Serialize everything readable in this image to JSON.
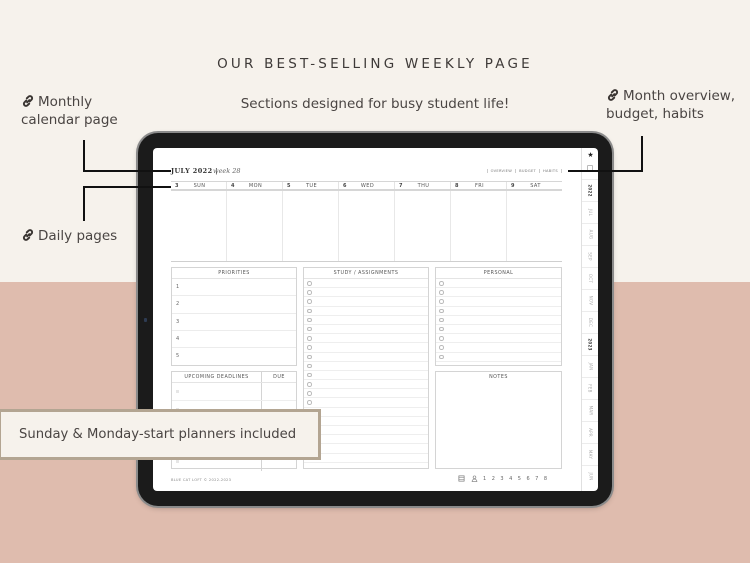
{
  "header": {
    "title": "OUR BEST-SELLING WEEKLY PAGE",
    "subtitle": "Sections designed for busy student life!"
  },
  "callouts": {
    "monthly": {
      "icon": "link-icon",
      "line1": "Monthly",
      "line2": "calendar page"
    },
    "daily": {
      "icon": "link-icon",
      "line1": "Daily pages"
    },
    "overview": {
      "icon": "link-icon",
      "line1": "Month overview,",
      "line2": "budget, habits"
    }
  },
  "banner": {
    "text": "Sunday & Monday-start planners included"
  },
  "planner": {
    "month_title": "JULY 2022 |",
    "week_label": "week 28",
    "top_links": [
      "OVERVIEW",
      "BUDGET",
      "HABITS"
    ],
    "days": [
      {
        "num": "3",
        "name": "SUN"
      },
      {
        "num": "4",
        "name": "MON"
      },
      {
        "num": "5",
        "name": "TUE"
      },
      {
        "num": "6",
        "name": "WED"
      },
      {
        "num": "7",
        "name": "THU"
      },
      {
        "num": "8",
        "name": "FRI"
      },
      {
        "num": "9",
        "name": "SAT"
      }
    ],
    "sections": {
      "priorities": {
        "title": "PRIORITIES",
        "rows": [
          "1",
          "2",
          "3",
          "4",
          "5"
        ]
      },
      "study": {
        "title": "STUDY / ASSIGNMENTS"
      },
      "personal": {
        "title": "PERSONAL"
      },
      "notes": {
        "title": "NOTES"
      },
      "deadlines": {
        "title": "UPCOMING DEADLINES",
        "due": "DUE"
      }
    },
    "footer": {
      "copyright": "BLUE CAT LOFT © 2022-2023",
      "nav_icons": [
        "notebook-icon",
        "user-icon"
      ],
      "pages": [
        "1",
        "2",
        "3",
        "4",
        "5",
        "6",
        "7",
        "8"
      ]
    },
    "sidebar": {
      "star_icon": "★",
      "tabs": [
        "2022",
        "JUL",
        "AUG",
        "SEP",
        "OCT",
        "NOV",
        "DEC",
        "2023",
        "JAN",
        "FEB",
        "MAR",
        "APR",
        "MAY",
        "JUN"
      ]
    }
  },
  "colors": {
    "cream": "#f6f2ec",
    "blush": "#dfbcae",
    "banner_border": "#b3a592",
    "tablet": "#1b1b1b"
  }
}
